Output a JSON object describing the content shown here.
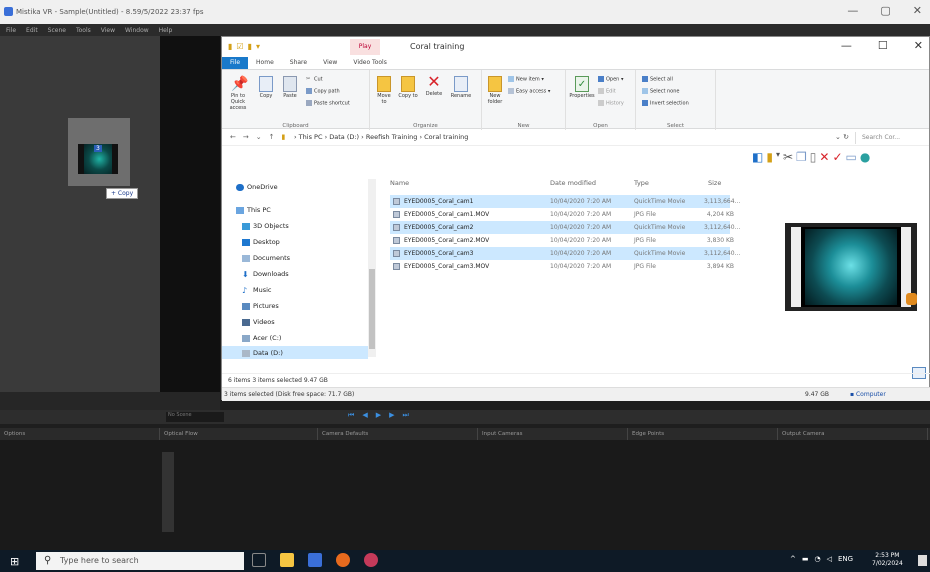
{
  "bg_app": {
    "title": "Mistika VR - Sample(Untitled) - 8.59/5/2022 23:37 fps",
    "menu": [
      "File",
      "Edit",
      "Scene",
      "Tools",
      "View",
      "Window",
      "Help"
    ],
    "copy_label": "+ Copy",
    "thumb_badge": "3",
    "field_label": "No Scene",
    "panels": [
      "Options",
      "Optical Flow",
      "Camera Defaults",
      "Input Cameras",
      "Edge Points",
      "Output Camera"
    ]
  },
  "explorer": {
    "play_tab": "Play",
    "title": "Coral training",
    "window_controls": [
      "—",
      "☐",
      "✕"
    ],
    "ribbon_tabs": [
      "File",
      "Home",
      "Share",
      "View",
      "Video Tools"
    ],
    "clipboard": {
      "pin": "Pin to Quick access",
      "copy": "Copy",
      "paste": "Paste",
      "cut": "Cut",
      "copy_path": "Copy path",
      "paste_shortcut": "Paste shortcut",
      "label": "Clipboard"
    },
    "organize": {
      "move_to": "Move to",
      "copy_to": "Copy to",
      "delete": "Delete",
      "rename": "Rename",
      "label": "Organize"
    },
    "new": {
      "new_folder": "New folder",
      "new_item": "New item",
      "easy_access": "Easy access",
      "label": "New"
    },
    "open": {
      "properties": "Properties",
      "open": "Open",
      "edit": "Edit",
      "history": "History",
      "label": "Open"
    },
    "select": {
      "select_all": "Select all",
      "select_none": "Select none",
      "invert": "Invert selection",
      "label": "Select"
    },
    "breadcrumb": [
      "This PC",
      "Data (D:)",
      "Reefish Training",
      "Coral training"
    ],
    "search_placeholder": "Search Cor...",
    "nav": [
      "OneDrive",
      "This PC",
      "3D Objects",
      "Desktop",
      "Documents",
      "Downloads",
      "Music",
      "Pictures",
      "Videos",
      "Acer (C:)",
      "Data (D:)"
    ],
    "columns": [
      "Name",
      "Date modified",
      "Type",
      "Size"
    ],
    "files": [
      {
        "name": "EYED0005_Coral_cam1",
        "date": "10/04/2020 7:20 AM",
        "type": "QuickTime Movie",
        "size": "3,113,664...",
        "selected": true
      },
      {
        "name": "EYED0005_Coral_cam1.MOV",
        "date": "10/04/2020 7:20 AM",
        "type": "JPG File",
        "size": "4,204 KB",
        "selected": false
      },
      {
        "name": "EYED0005_Coral_cam2",
        "date": "10/04/2020 7:20 AM",
        "type": "QuickTime Movie",
        "size": "3,112,640...",
        "selected": true
      },
      {
        "name": "EYED0005_Coral_cam2.MOV",
        "date": "10/04/2020 7:20 AM",
        "type": "JPG File",
        "size": "3,830 KB",
        "selected": false
      },
      {
        "name": "EYED0005_Coral_cam3",
        "date": "10/04/2020 7:20 AM",
        "type": "QuickTime Movie",
        "size": "3,112,640...",
        "selected": true
      },
      {
        "name": "EYED0005_Coral_cam3.MOV",
        "date": "10/04/2020 7:20 AM",
        "type": "JPG File",
        "size": "3,894 KB",
        "selected": false
      }
    ],
    "status_inner": "6 items   3 items selected  9.47 GB",
    "status_outer": "3 items selected (Disk free space: 71.7 GB)",
    "status_size": "9.47 GB",
    "status_computer": "Computer"
  },
  "taskbar": {
    "search_placeholder": "Type here to search",
    "lang": "ENG",
    "time": "2:53 PM",
    "date": "7/02/2024"
  }
}
